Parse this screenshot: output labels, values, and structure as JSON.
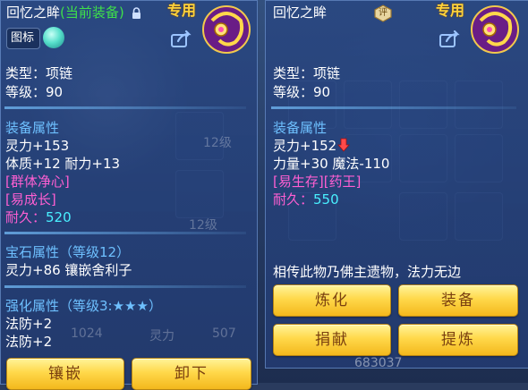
{
  "left_panel": {
    "title": "回忆之眸",
    "current_equipped": "(当前装备)",
    "exclusive": "专用",
    "icon_tag": "图标",
    "type_line": "类型：项链",
    "level_line": "等级：90",
    "equip_attr_heading": "装备属性",
    "stats": [
      "灵力+153",
      "体质+12 耐力+13"
    ],
    "special_effect": "[群体净心]",
    "special_skill": "[易成长]",
    "durability_label": "耐久：",
    "durability_value": "520",
    "gem_heading": "宝石属性（等级12）",
    "gem_stat": "灵力+86 镶嵌舍利子",
    "enhance_heading": "强化属性（等级3:★★★）",
    "enhance_stats": [
      "法防+2",
      "法防+2"
    ],
    "buttons": {
      "inlay": "镶嵌",
      "unequip": "卸下"
    }
  },
  "right_panel": {
    "title": "回忆之眸",
    "seal_glyph": "评",
    "exclusive": "专用",
    "type_line": "类型：项链",
    "level_line": "等级：90",
    "equip_attr_heading": "装备属性",
    "stats": [
      "灵力+152",
      "力量+30 魔法-110"
    ],
    "special_line": "[易生存][药王]",
    "durability_label": "耐久：",
    "durability_value": "550",
    "description": "相传此物乃佛主遗物，法力无边",
    "buttons": {
      "refine": "炼化",
      "equip": "装备",
      "donate": "捐献",
      "extract": "提炼"
    }
  },
  "background": {
    "grade_badges": [
      "12级",
      "12级"
    ],
    "stat_numbers": [
      "1024",
      "507",
      "683037"
    ],
    "stat_label": "灵力"
  },
  "colors": {
    "title_white": "#ffffff",
    "current_green": "#3ee04a",
    "exclusive_gold": "#ffd23a",
    "section_blue": "#6ec0ff",
    "special_pink": "#ff5fd2",
    "durability_cyan": "#49f0ff",
    "button_gold": "#ffd84a",
    "button_text": "#7a4010"
  },
  "icons": [
    "lock-icon",
    "necklace-item-icon",
    "share-icon",
    "teal-orb-icon",
    "appraisal-seal-icon",
    "down-arrow-icon"
  ]
}
